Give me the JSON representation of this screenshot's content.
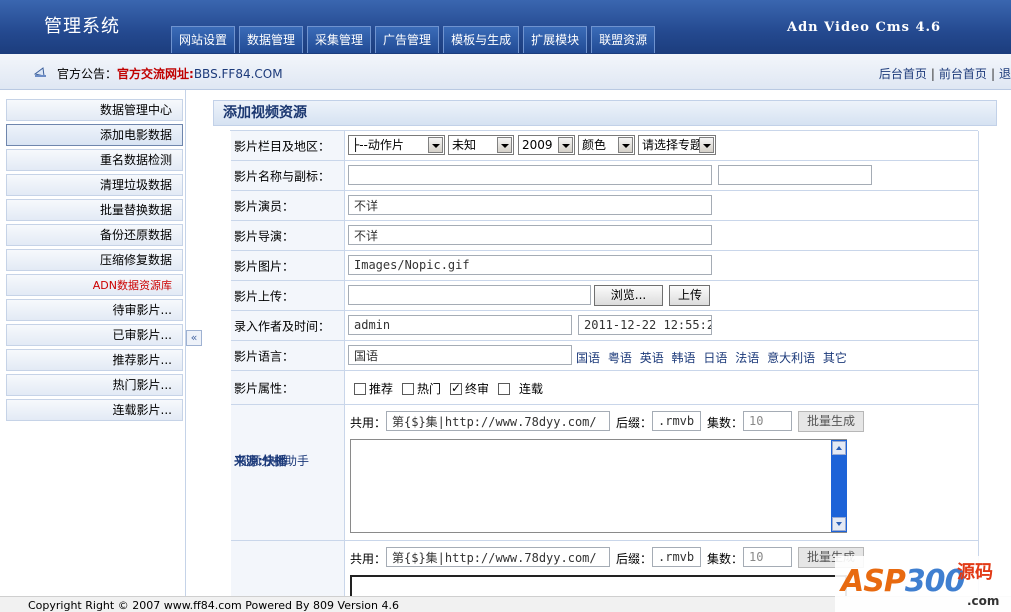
{
  "header": {
    "app_title": "管理系统",
    "nav_tabs": [
      "网站设置",
      "数据管理",
      "采集管理",
      "广告管理",
      "模板与生成",
      "扩展模块",
      "联盟资源"
    ],
    "version": "Adn Video Cms 4.6"
  },
  "notice": {
    "label": "官方公告：",
    "link_label": "官方交流网址:",
    "url": "BBS.FF84.COM",
    "top_links": [
      "后台首页",
      "前台首页",
      "退"
    ]
  },
  "sidebar": {
    "items": [
      {
        "label": "数据管理中心"
      },
      {
        "label": "添加电影数据"
      },
      {
        "label": "重名数据检测"
      },
      {
        "label": "清理垃圾数据"
      },
      {
        "label": "批量替换数据"
      },
      {
        "label": "备份还原数据"
      },
      {
        "label": "压缩修复数据"
      },
      {
        "label": "ADN数据资源库"
      },
      {
        "label": "待审影片..."
      },
      {
        "label": "已审影片..."
      },
      {
        "label": "推荐影片..."
      },
      {
        "label": "热门影片..."
      },
      {
        "label": "连载影片..."
      }
    ],
    "collapse_glyph": "«"
  },
  "panel": {
    "title": "添加视频资源",
    "rows": {
      "category": {
        "label": "影片栏目及地区：",
        "category_value": "├--动作片",
        "region_value": "未知",
        "year_value": "2009",
        "color_value": "颜色",
        "topic_value": "请选择专题"
      },
      "name": {
        "label": "影片名称与副标：",
        "name_value": "",
        "subtitle_value": ""
      },
      "actors": {
        "label": "影片演员：",
        "value": "不详"
      },
      "director": {
        "label": "影片导演：",
        "value": "不详"
      },
      "image": {
        "label": "影片图片：",
        "value": "Images/Nopic.gif"
      },
      "upload": {
        "label": "影片上传：",
        "value": "",
        "browse_label": "浏览...",
        "upload_label": "上传"
      },
      "author": {
        "label": "录入作者及时间：",
        "author_value": "admin",
        "time_value": "2011-12-22 12:55:2"
      },
      "language": {
        "label": "影片语言：",
        "value": "国语",
        "options": [
          "国语",
          "粤语",
          "英语",
          "韩语",
          "日语",
          "法语",
          "意大利语",
          "其它"
        ]
      },
      "attributes": {
        "label": "影片属性：",
        "options": [
          {
            "label": "推荐",
            "checked": false
          },
          {
            "label": "热门",
            "checked": false
          },
          {
            "label": "终审",
            "checked": true
          },
          {
            "label": "连载",
            "checked": false
          }
        ]
      },
      "source1": {
        "source_prefix": "来源:",
        "source_name": "快播",
        "helper": "视频分析助手",
        "shared_label": "共用：",
        "shared_value": "第{$}集|http://www.78dyy.com/",
        "suffix_label": "后缀：",
        "suffix_value": ".rmvb",
        "count_label": "集数：",
        "count_value": "10",
        "generate_label": "批量生成"
      },
      "source2": {
        "shared_label": "共用：",
        "shared_value": "第{$}集|http://www.78dyy.com/",
        "suffix_label": "后缀：",
        "suffix_value": ".rmvb",
        "count_label": "集数：",
        "count_value": "10",
        "generate_label": "批量生成"
      }
    }
  },
  "footer": {
    "text": "Copyright Right © 2007 www.ff84.com Powered By 809 Version 4.6"
  },
  "watermark": {
    "brand_a": "ASP",
    "brand_b": "300",
    "brand_cn": "源码",
    "domain": ".com"
  },
  "colors": {
    "header": "#24498f",
    "accent_red": "#cc0000",
    "link": "#1c3a7a",
    "scroll_blue": "#1d63d8"
  }
}
